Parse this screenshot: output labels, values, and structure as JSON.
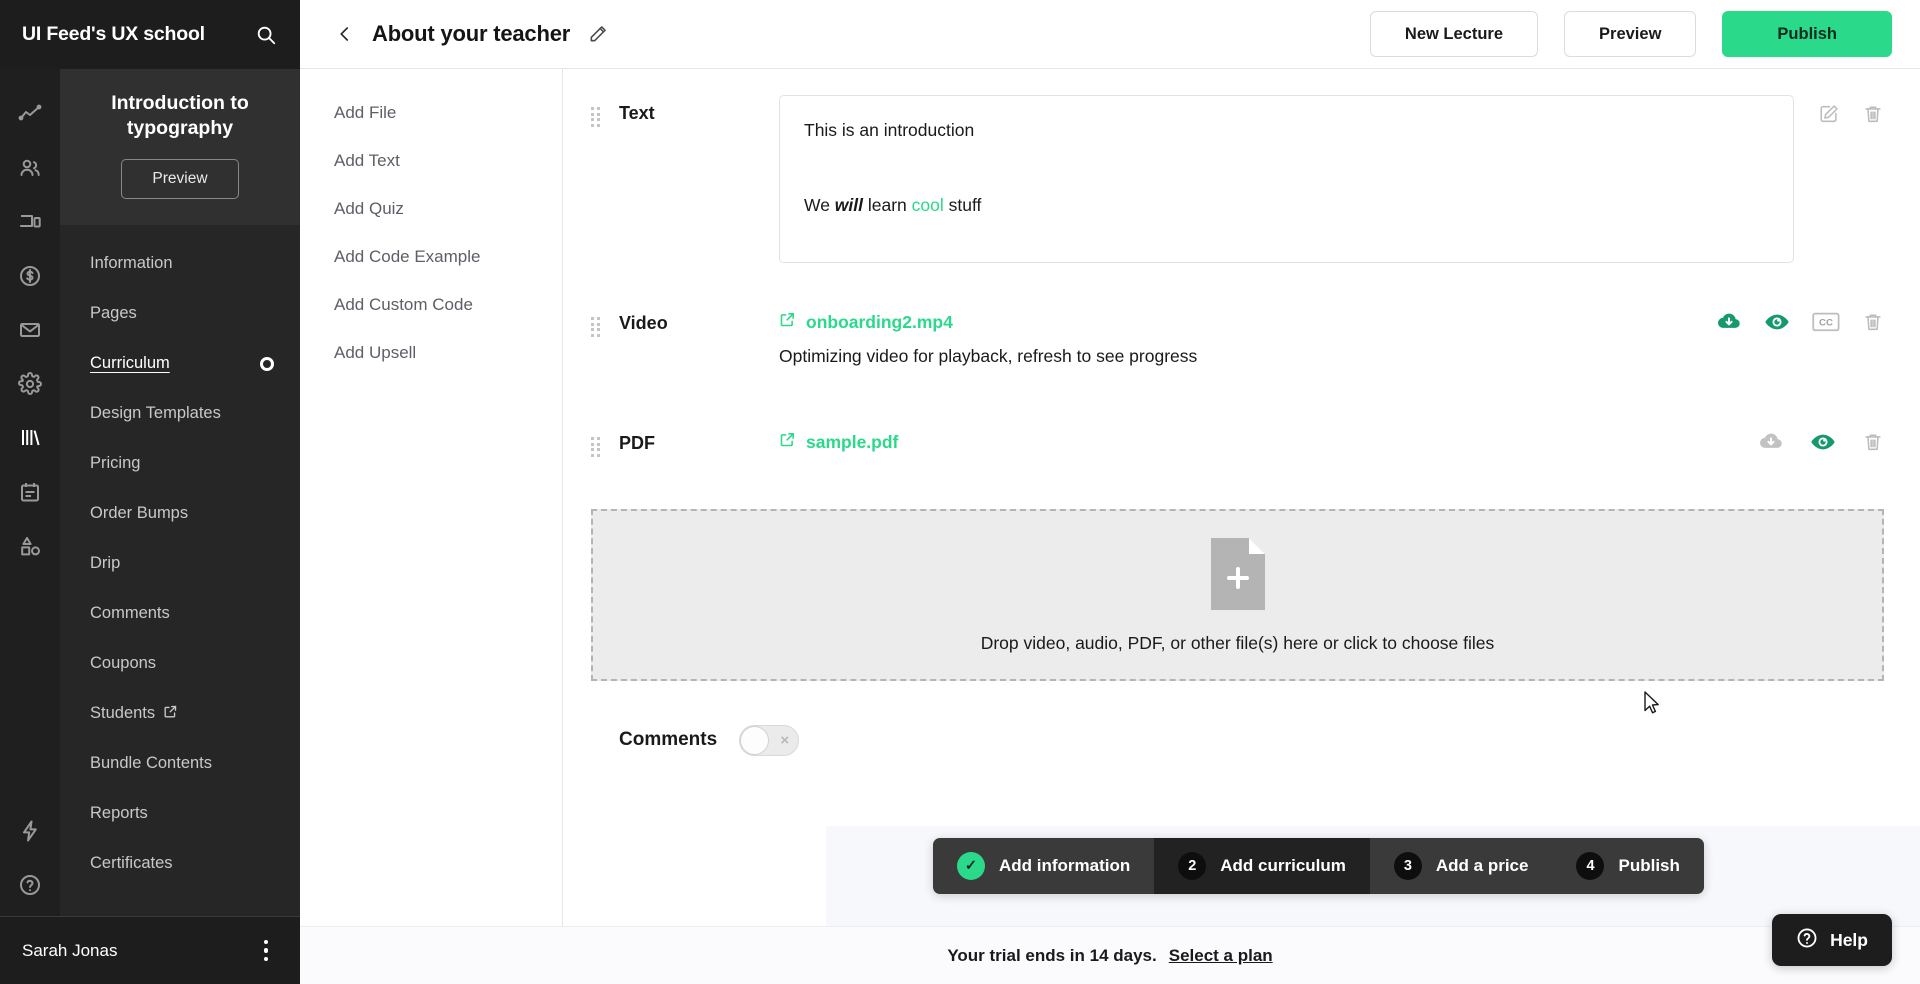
{
  "brand": {
    "title": "UI Feed's UX school",
    "search_icon": "search-icon"
  },
  "sidebar": {
    "rail_icons": [
      {
        "name": "analytics-icon",
        "active": false
      },
      {
        "name": "people-icon",
        "active": false
      },
      {
        "name": "devices-icon",
        "active": false
      },
      {
        "name": "dollar-circle-icon",
        "active": false
      },
      {
        "name": "mail-icon",
        "active": false
      },
      {
        "name": "gear-icon",
        "active": false
      },
      {
        "name": "books-icon",
        "active": true
      },
      {
        "name": "calendar-icon",
        "active": false
      },
      {
        "name": "shapes-icon",
        "active": false
      },
      {
        "name": "lightning-icon",
        "active": false
      },
      {
        "name": "help-circle-icon",
        "active": false
      },
      {
        "name": "graduation-cap-icon",
        "active": false
      }
    ],
    "course_title": "Introduction to typography",
    "preview_label": "Preview",
    "items": [
      {
        "label": "Information",
        "active": false,
        "external": false,
        "indicator": false
      },
      {
        "label": "Pages",
        "active": false,
        "external": false,
        "indicator": false
      },
      {
        "label": "Curriculum",
        "active": true,
        "external": false,
        "indicator": true
      },
      {
        "label": "Design Templates",
        "active": false,
        "external": false,
        "indicator": false
      },
      {
        "label": "Pricing",
        "active": false,
        "external": false,
        "indicator": false
      },
      {
        "label": "Order Bumps",
        "active": false,
        "external": false,
        "indicator": false
      },
      {
        "label": "Drip",
        "active": false,
        "external": false,
        "indicator": false
      },
      {
        "label": "Comments",
        "active": false,
        "external": false,
        "indicator": false
      },
      {
        "label": "Coupons",
        "active": false,
        "external": false,
        "indicator": false
      },
      {
        "label": "Students",
        "active": false,
        "external": true,
        "indicator": false
      },
      {
        "label": "Bundle Contents",
        "active": false,
        "external": false,
        "indicator": false
      },
      {
        "label": "Reports",
        "active": false,
        "external": false,
        "indicator": false
      },
      {
        "label": "Certificates",
        "active": false,
        "external": false,
        "indicator": false
      }
    ],
    "user_name": "Sarah Jonas",
    "kebab_icon": "more-vertical-icon"
  },
  "topbar": {
    "back_icon": "chevron-left-icon",
    "title": "About your teacher",
    "edit_icon": "pencil-icon",
    "new_lecture_label": "New Lecture",
    "preview_label": "Preview",
    "publish_label": "Publish",
    "publish_color": "#2bd98a"
  },
  "add_panel": {
    "items": [
      {
        "label": "Add File"
      },
      {
        "label": "Add Text"
      },
      {
        "label": "Add Quiz"
      },
      {
        "label": "Add Code Example"
      },
      {
        "label": "Add Custom Code"
      },
      {
        "label": "Add Upsell"
      }
    ]
  },
  "blocks": {
    "text": {
      "type_label": "Text",
      "line1": "This is an introduction",
      "line2_prefix": "We ",
      "line2_bold": "will",
      "line2_mid": " learn ",
      "line2_accent": "cool",
      "line2_suffix": " stuff",
      "actions": [
        {
          "name": "edit-icon",
          "state": "inactive"
        },
        {
          "name": "trash-icon",
          "state": "inactive"
        }
      ]
    },
    "video": {
      "type_label": "Video",
      "file_name": "onboarding2.mp4",
      "status_note": "Optimizing video for playback, refresh to see progress",
      "actions": [
        {
          "name": "cloud-download-icon",
          "state": "active"
        },
        {
          "name": "eye-icon",
          "state": "active"
        },
        {
          "name": "closed-caption-icon",
          "state": "inactive"
        },
        {
          "name": "trash-icon",
          "state": "inactive"
        }
      ]
    },
    "pdf": {
      "type_label": "PDF",
      "file_name": "sample.pdf",
      "actions": [
        {
          "name": "cloud-download-icon",
          "state": "inactive"
        },
        {
          "name": "eye-icon",
          "state": "active"
        },
        {
          "name": "trash-icon",
          "state": "inactive"
        }
      ]
    }
  },
  "dropzone": {
    "icon": "file-add-icon",
    "text": "Drop video, audio, PDF, or other file(s) here or click to choose files"
  },
  "comments_setting": {
    "label": "Comments",
    "enabled": false,
    "off_glyph": "×"
  },
  "stepper": {
    "steps": [
      {
        "badge": "✓",
        "label": "Add information",
        "state": "done"
      },
      {
        "badge": "2",
        "label": "Add curriculum",
        "state": "active"
      },
      {
        "badge": "3",
        "label": "Add a price",
        "state": "pending"
      },
      {
        "badge": "4",
        "label": "Publish",
        "state": "pending"
      }
    ]
  },
  "trial": {
    "message": "Your trial ends in 14 days.",
    "link_label": "Select a plan"
  },
  "help": {
    "label": "Help",
    "icon": "question-circle-icon"
  },
  "colors": {
    "accent_green": "#2bd98a",
    "dark_nav": "#262626",
    "rail": "#1f1f1f"
  }
}
